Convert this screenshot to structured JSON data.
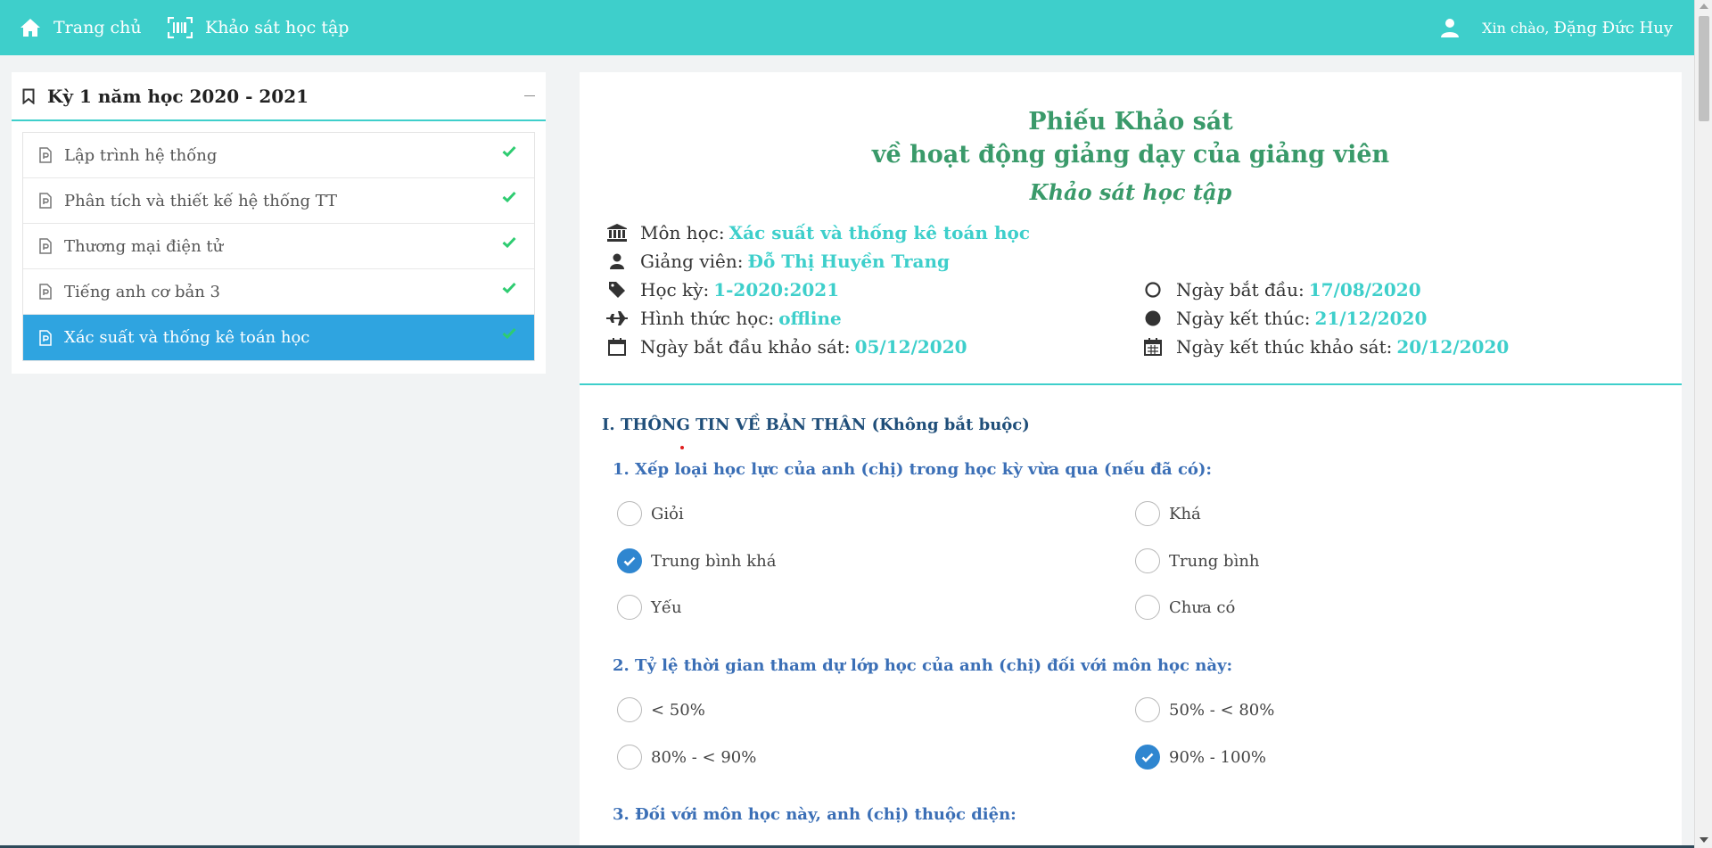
{
  "nav": {
    "home_label": "Trang chủ",
    "survey_label": "Khảo sát học tập",
    "greeting": "Xin chào,",
    "user_name": "Đặng Đức Huy"
  },
  "colors": {
    "accent": "#3ecfcb",
    "active": "#2fa4e0",
    "check": "#2ecc71",
    "title_green": "#3a9a6a"
  },
  "sidebar": {
    "title": "Kỳ 1 năm học 2020 - 2021",
    "courses": [
      {
        "label": "Lập trình hệ thống",
        "completed": true
      },
      {
        "label": "Phân tích và thiết kế hệ thống TT",
        "completed": true
      },
      {
        "label": "Thương mại điện tử",
        "completed": true
      },
      {
        "label": "Tiếng anh cơ bản 3",
        "completed": true
      },
      {
        "label": "Xác suất và thống kê toán học",
        "completed": true,
        "active": true
      }
    ]
  },
  "header": {
    "title_line1": "Phiếu Khảo sát",
    "title_line2": "về hoạt động giảng dạy của giảng viên",
    "subtitle": "Khảo sát học tập",
    "subject_label": "Môn học:",
    "subject_value": "Xác suất và thống kê toán học",
    "lecturer_label": "Giảng viên:",
    "lecturer_value": "Đỗ Thị Huyền Trang",
    "semester_label": "Học kỳ:",
    "semester_value": "1-2020:2021",
    "mode_label": "Hình thức học:",
    "mode_value": "offline",
    "survey_start_label": "Ngày bắt đầu khảo sát:",
    "survey_start_value": "05/12/2020",
    "start_label": "Ngày bắt đầu:",
    "start_value": "17/08/2020",
    "end_label": "Ngày kết thúc:",
    "end_value": "21/12/2020",
    "survey_end_label": "Ngày kết thúc khảo sát:",
    "survey_end_value": "20/12/2020"
  },
  "section1": {
    "title": "I. THÔNG TIN VỀ BẢN THÂN (Không bắt buộc)",
    "q1": {
      "text": "1. Xếp loại học lực của anh (chị) trong học kỳ vừa qua (nếu đã có):",
      "options": [
        {
          "label": "Giỏi",
          "checked": false
        },
        {
          "label": "Khá",
          "checked": false
        },
        {
          "label": "Trung bình khá",
          "checked": true
        },
        {
          "label": "Trung bình",
          "checked": false
        },
        {
          "label": "Yếu",
          "checked": false
        },
        {
          "label": "Chưa có",
          "checked": false
        }
      ]
    },
    "q2": {
      "text": "2. Tỷ lệ thời gian tham dự lớp học của anh (chị) đối với môn học này:",
      "options": [
        {
          "label": "< 50%",
          "checked": false
        },
        {
          "label": "50% - < 80%",
          "checked": false
        },
        {
          "label": "80% - < 90%",
          "checked": false
        },
        {
          "label": "90% - 100%",
          "checked": true
        }
      ]
    },
    "q3": {
      "text": "3. Đối với môn học này, anh (chị) thuộc diện:"
    }
  }
}
